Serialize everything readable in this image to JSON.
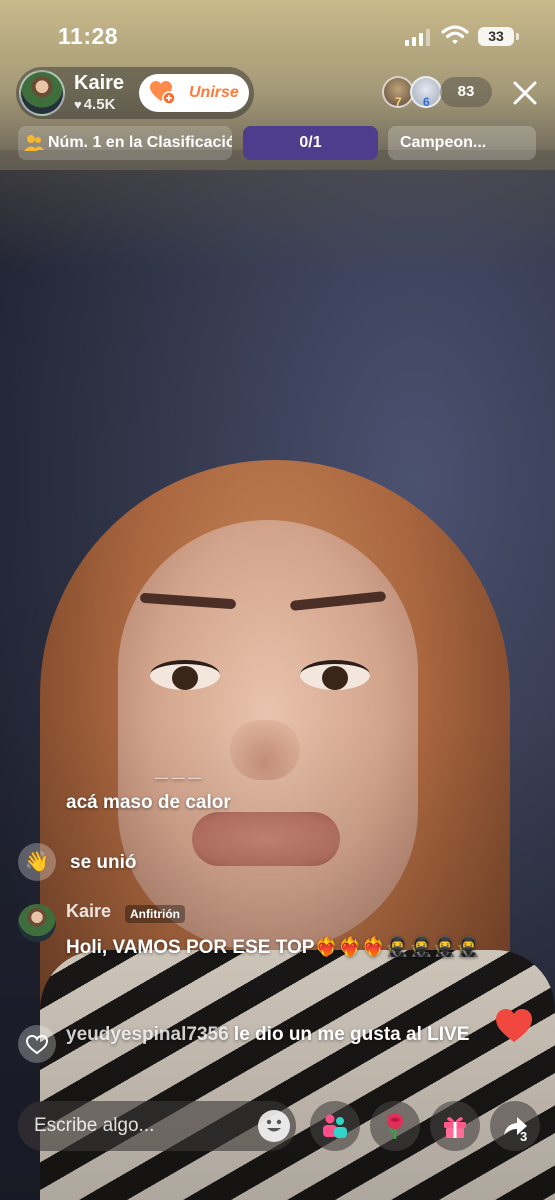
{
  "status_bar": {
    "time": "11:28",
    "battery": "33"
  },
  "host": {
    "name": "Kaire",
    "likes": "4.5K",
    "join_label": "Unirse"
  },
  "viewers": {
    "badge_1": "7",
    "badge_2": "6",
    "count": "83"
  },
  "info_bar": {
    "ranking": "Núm. 1 en la Clasificación",
    "goal_progress": "0/1",
    "champion": "Campeon..."
  },
  "comments": [
    {
      "text": "acá maso de calor"
    },
    {
      "text": "se unió"
    },
    {
      "user": "Kaire",
      "badge": "Anfitrión",
      "text": "Holi, VAMOS POR ESE TOP❤️‍🔥❤️‍🔥❤️‍🔥🥷🥷🥷🥷"
    },
    {
      "user": "yeudyespinal7356",
      "text": " le dio un me gusta al LIVE"
    }
  ],
  "bottom_bar": {
    "input_placeholder": "Escribe algo...",
    "share_count": "3"
  },
  "colors": {
    "join_accent": "#ff7a3b",
    "goal_pill": "#4e3c8c",
    "like_heart": "#f0473f"
  }
}
